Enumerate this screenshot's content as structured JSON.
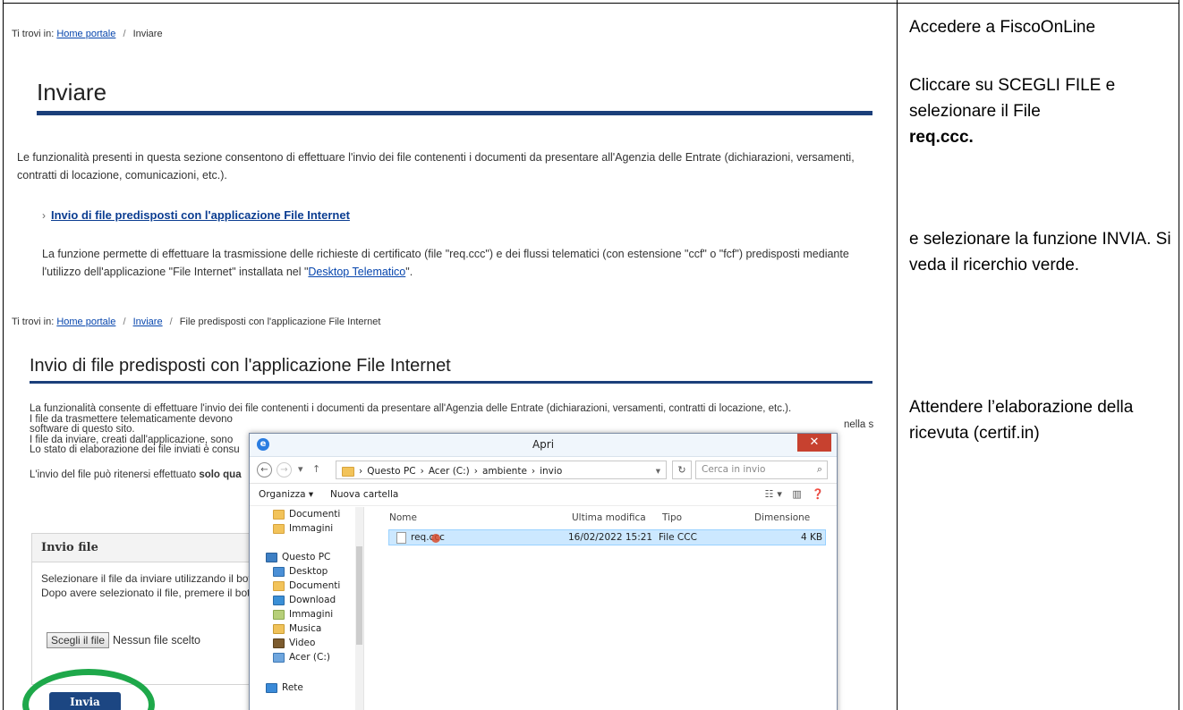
{
  "left_screenshot": {
    "breadcrumb1": {
      "prefix": "Ti trovi in:",
      "home": "Home portale",
      "sep": "/",
      "current": "Inviare"
    },
    "page_title": "Inviare",
    "intro": "Le funzionalità presenti in questa sezione consentono di effettuare l'invio dei file contenenti i documenti da presentare all'Agenzia delle Entrate (dichiarazioni, versamenti, contratti di locazione, comunicazioni, etc.).",
    "link_title": "Invio di file predisposti con l'applicazione File Internet",
    "link_desc_a": "La funzione permette di effettuare la trasmissione delle richieste di certificato (file \"req.ccc\") e dei flussi telematici (con estensione \"ccf\" o \"fcf\") predisposti mediante l'utilizzo dell'applicazione \"File Internet\" installata nel \"",
    "link_desc_link": "Desktop Telematico",
    "link_desc_b": "\".",
    "breadcrumb2": {
      "prefix": "Ti trovi in:",
      "home": "Home portale",
      "sep": "/",
      "mid": "Inviare",
      "current": "File predisposti con l'applicazione File Internet"
    },
    "section_title": "Invio di file predisposti con l'applicazione File Internet",
    "body_lines": [
      "La funzionalità consente di effettuare l'invio dei file contenenti i documenti da presentare all'Agenzia delle Entrate (dichiarazioni, versamenti, contratti di locazione, etc.).",
      "I file da trasmettere telematicamente devono",
      "software di questo sito.",
      "I file da inviare, creati dall'applicazione, sono",
      "Lo stato di elaborazione dei file inviati è consu"
    ],
    "body_line_trail": "nella s",
    "sent_prefix": "L'invio del file può ritenersi effettuato",
    "sent_bold": "solo qua",
    "panel": {
      "title": "Invio file",
      "line1": "Selezionare il file da inviare utilizzando il bott",
      "line2": "Dopo avere selezionato il file, premere il bott",
      "choose_label": "Scegli il file",
      "no_file": "Nessun file scelto"
    },
    "invia_label": "Invia"
  },
  "dialog": {
    "title": "Apri",
    "close": "✕",
    "path": [
      "Questo PC",
      "Acer (C:)",
      "ambiente",
      "invio"
    ],
    "search_placeholder": "Cerca in invio",
    "organize": "Organizza ▾",
    "new_folder": "Nuova cartella",
    "nav_items": [
      {
        "label": "Documenti",
        "icon": "folder"
      },
      {
        "label": "Immagini",
        "icon": "folder"
      },
      {
        "label": "Questo PC",
        "icon": "pc"
      },
      {
        "label": "Desktop",
        "icon": "desktop"
      },
      {
        "label": "Documenti",
        "icon": "folder"
      },
      {
        "label": "Download",
        "icon": "download"
      },
      {
        "label": "Immagini",
        "icon": "images"
      },
      {
        "label": "Musica",
        "icon": "music"
      },
      {
        "label": "Video",
        "icon": "video"
      },
      {
        "label": "Acer (C:)",
        "icon": "drive"
      },
      {
        "label": "Rete",
        "icon": "network"
      }
    ],
    "columns": {
      "name": "Nome",
      "modified": "Ultima modifica",
      "type": "Tipo",
      "size": "Dimensione"
    },
    "file": {
      "name": "req.ccc",
      "modified": "16/02/2022 15:21",
      "type": "File CCC",
      "size": "4 KB"
    }
  },
  "instructions": {
    "step1": "Accedere a FiscoOnLine",
    "step2_a": "Cliccare su SCEGLI FILE e selezionare il File",
    "step2_b": "req.ccc.",
    "step3": "e selezionare la funzione INVIA. Si veda il ricerchio verde.",
    "step4": "Attendere l’elaborazione della ricevuta (certif.in)"
  },
  "colors": {
    "highlight_ring": "#1ea84a",
    "invia_button": "#1c4682",
    "title_rule": "#1b3f7a",
    "dialog_close": "#c7412f"
  }
}
